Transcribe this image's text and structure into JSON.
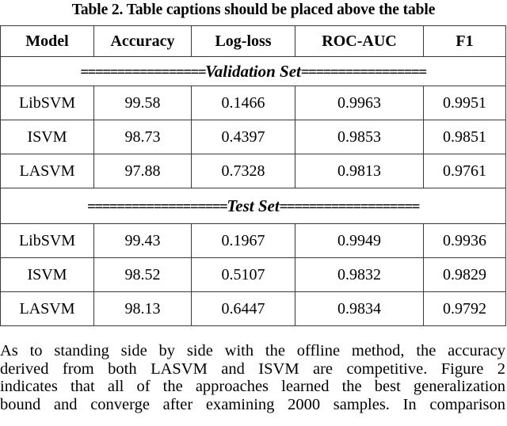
{
  "caption": "Table 2. Table captions should be placed above the table",
  "table": {
    "headers": [
      "Model",
      "Accuracy",
      "Log-loss",
      "ROC-AUC",
      "F1"
    ],
    "sections": [
      {
        "name": "Validation Set",
        "left_rule": "=================",
        "right_rule": "=================",
        "rows": [
          [
            "LibSVM",
            "99.58",
            "0.1466",
            "0.9963",
            "0.9951"
          ],
          [
            "ISVM",
            "98.73",
            "0.4397",
            "0.9853",
            "0.9851"
          ],
          [
            "LASVM",
            "97.88",
            "0.7328",
            "0.9813",
            "0.9761"
          ]
        ]
      },
      {
        "name": "Test Set",
        "left_rule": "===================",
        "right_rule": "===================",
        "rows": [
          [
            "LibSVM",
            "99.43",
            "0.1967",
            "0.9949",
            "0.9936"
          ],
          [
            "ISVM",
            "98.52",
            "0.5107",
            "0.9832",
            "0.9829"
          ],
          [
            "LASVM",
            "98.13",
            "0.6447",
            "0.9834",
            "0.9792"
          ]
        ]
      }
    ]
  },
  "paragraph": {
    "lines": [
      "As to standing side by side with the offline method, the accuracy",
      "derived from both LASVM and ISVM are competitive. Figure 2",
      "indicates that all of the approaches learned the best generalization",
      "bound and converge after examining 2000 samples. In comparison"
    ]
  }
}
